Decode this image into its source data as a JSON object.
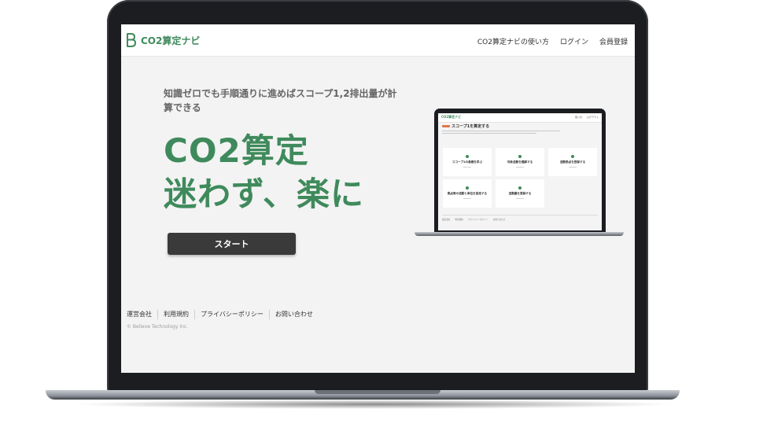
{
  "header": {
    "logo_text": "CO2算定ナビ",
    "nav": [
      "CO2算定ナビの使い方",
      "ログイン",
      "会員登録"
    ]
  },
  "hero": {
    "subhead": "知識ゼロでも手順通りに進めばスコープ1,2排出量が計算できる",
    "headline_line1": "CO2算定",
    "headline_line2": "迷わず、楽に",
    "start_button": "スタート"
  },
  "mockup": {
    "logo_text": "CO2算定ナビ",
    "nav": [
      "使い方",
      "ログアウト"
    ],
    "title": "スコープ1を算定する",
    "cards": [
      "スコープ1の基礎を学ぶ",
      "対象活動を理解する",
      "活動拠点を登録する",
      "拠点毎の活動と単位を設定する",
      "活動量を登録する"
    ],
    "footer": [
      "運営会社",
      "利用規約",
      "プライバシーポリシー",
      "お問い合わせ"
    ]
  },
  "footer": {
    "links": [
      "運営会社",
      "利用規約",
      "プライバシーポリシー",
      "お問い合わせ"
    ],
    "copyright": "© Believe Technology Inc."
  },
  "colors": {
    "brand_green": "#3f8a5c",
    "button_dark": "#3a3a3a",
    "page_bg": "#f3f3f3",
    "laptop_frame": "#1b1d21"
  }
}
